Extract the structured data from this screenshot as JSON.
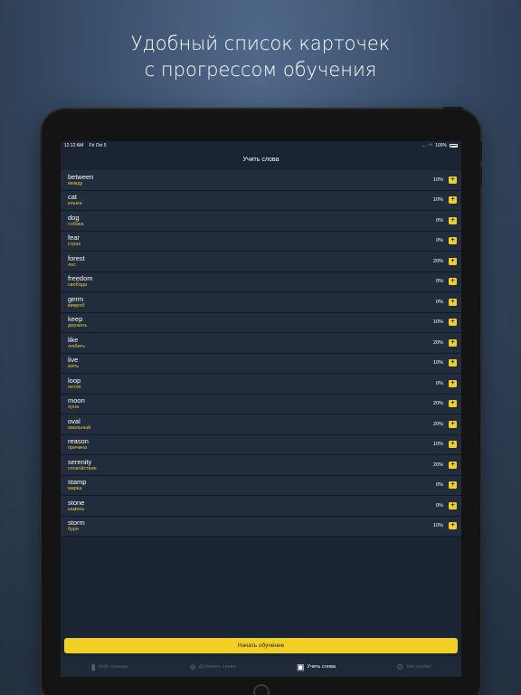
{
  "headline": {
    "line1": "Удобный список карточек",
    "line2": "с прогрессом обучения"
  },
  "statusbar": {
    "time": "12:12 AM",
    "date": "Fri Oct 5",
    "signal": "...",
    "battery": "100%"
  },
  "nav": {
    "title": "Учить слова"
  },
  "words": [
    {
      "en": "between",
      "ru": "между",
      "pct": "10%"
    },
    {
      "en": "cat",
      "ru": "кошка",
      "pct": "10%"
    },
    {
      "en": "dog",
      "ru": "собака",
      "pct": "0%"
    },
    {
      "en": "fear",
      "ru": "страх",
      "pct": "0%"
    },
    {
      "en": "forest",
      "ru": "лес",
      "pct": "20%"
    },
    {
      "en": "freedom",
      "ru": "свобода",
      "pct": "0%"
    },
    {
      "en": "germ",
      "ru": "микроб",
      "pct": "0%"
    },
    {
      "en": "keep",
      "ru": "держать",
      "pct": "10%"
    },
    {
      "en": "like",
      "ru": "любить",
      "pct": "20%"
    },
    {
      "en": "live",
      "ru": "жить",
      "pct": "10%"
    },
    {
      "en": "loop",
      "ru": "петля",
      "pct": "0%"
    },
    {
      "en": "moon",
      "ru": "луна",
      "pct": "20%"
    },
    {
      "en": "oval",
      "ru": "овальный",
      "pct": "20%"
    },
    {
      "en": "reason",
      "ru": "причина",
      "pct": "10%"
    },
    {
      "en": "serenity",
      "ru": "спокойствие",
      "pct": "20%"
    },
    {
      "en": "stamp",
      "ru": "марка",
      "pct": "0%"
    },
    {
      "en": "stone",
      "ru": "камень",
      "pct": "0%"
    },
    {
      "en": "storm",
      "ru": "буря",
      "pct": "10%"
    }
  ],
  "start_button": "Начать обучение",
  "tabs": [
    {
      "label": "Мой словарь",
      "icon": "book-icon",
      "glyph": "▮",
      "active": false
    },
    {
      "label": "Добавить слово",
      "icon": "add-circle-icon",
      "glyph": "⊕",
      "active": false
    },
    {
      "label": "Учить слова",
      "icon": "cards-icon",
      "glyph": "▣",
      "active": true
    },
    {
      "label": "Настройки",
      "icon": "gear-icon",
      "glyph": "⚙",
      "active": false
    }
  ],
  "colors": {
    "accent": "#f2cf24",
    "translation": "#e8c640",
    "background": "#1b2432",
    "row": "#212c3c"
  }
}
